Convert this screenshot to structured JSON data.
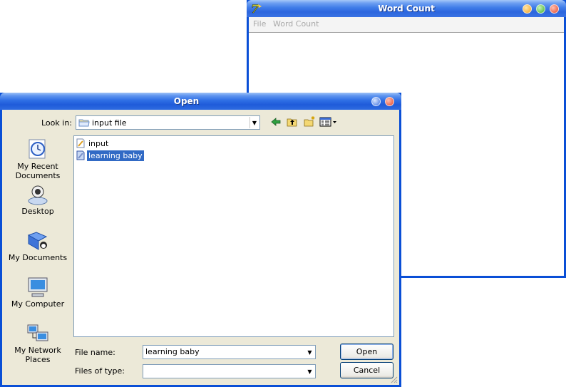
{
  "word_count_window": {
    "title": "Word Count",
    "app_icon": "7-icon",
    "menu": [
      {
        "label": "File"
      },
      {
        "label": "Word Count"
      }
    ]
  },
  "open_dialog": {
    "title": "Open",
    "look_in_label": "Look in:",
    "look_in_value": "input file",
    "places": [
      {
        "label_1": "My Recent",
        "label_2": "Documents",
        "icon": "recent-documents-icon"
      },
      {
        "label_1": "Desktop",
        "icon": "desktop-icon"
      },
      {
        "label_1": "My Documents",
        "icon": "my-documents-icon"
      },
      {
        "label_1": "My Computer",
        "icon": "my-computer-icon"
      },
      {
        "label_1": "My Network",
        "label_2": "Places",
        "icon": "network-places-icon"
      }
    ],
    "files": [
      {
        "name": "input",
        "selected": false
      },
      {
        "name": "learning baby",
        "selected": true
      }
    ],
    "file_name_label": "File name:",
    "file_name_value": "learning baby",
    "file_type_label": "Files of type:",
    "file_type_value": "",
    "open_button": "Open",
    "cancel_button": "Cancel"
  },
  "colors": {
    "titlebar": "#2c66de",
    "dialog_bg": "#ece9d8",
    "selection": "#316ac5"
  }
}
